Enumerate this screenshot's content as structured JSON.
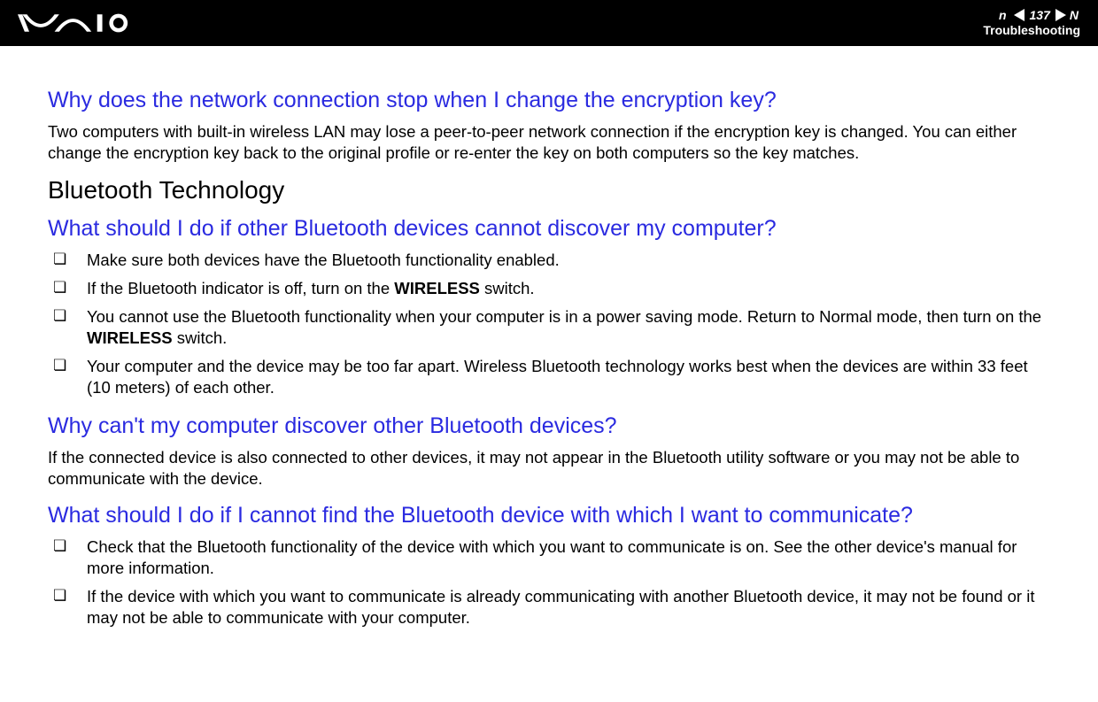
{
  "header": {
    "page_number": "137",
    "section_label": "Troubleshooting",
    "n_letter": "N",
    "n_letter2": "n"
  },
  "content": {
    "q1": "Why does the network connection stop when I change the encryption key?",
    "p1": "Two computers with built-in wireless LAN may lose a peer-to-peer network connection if the encryption key is changed. You can either change the encryption key back to the original profile or re-enter the key on both computers so the key matches.",
    "heading1": "Bluetooth Technology",
    "q2": "What should I do if other Bluetooth devices cannot discover my computer?",
    "b1": {
      "i1": "Make sure both devices have the Bluetooth functionality enabled.",
      "i2_pre": "If the Bluetooth indicator is off, turn on the ",
      "i2_bold": "WIRELESS",
      "i2_post": " switch.",
      "i3_pre": "You cannot use the Bluetooth functionality when your computer is in a power saving mode. Return to Normal mode, then turn on the ",
      "i3_bold": "WIRELESS",
      "i3_post": " switch.",
      "i4": "Your computer and the device may be too far apart. Wireless Bluetooth technology works best when the devices are within 33 feet (10 meters) of each other."
    },
    "q3": "Why can't my computer discover other Bluetooth devices?",
    "p3": "If the connected device is also connected to other devices, it may not appear in the Bluetooth utility software or you may not be able to communicate with the device.",
    "q4": "What should I do if I cannot find the Bluetooth device with which I want to communicate?",
    "b2": {
      "i1": "Check that the Bluetooth functionality of the device with which you want to communicate is on. See the other device's manual for more information.",
      "i2": "If the device with which you want to communicate is already communicating with another Bluetooth device, it may not be found or it may not be able to communicate with your computer."
    }
  }
}
